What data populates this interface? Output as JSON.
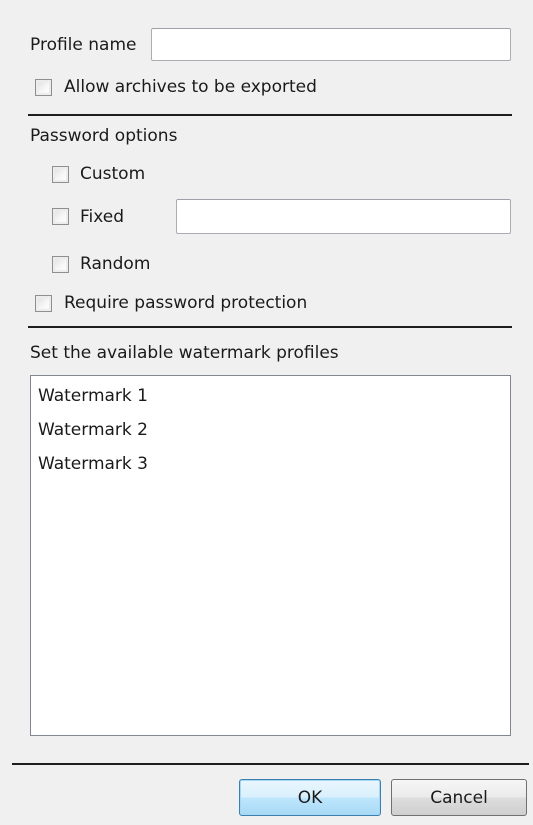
{
  "profile": {
    "name_label": "Profile name",
    "name_value": ""
  },
  "export": {
    "allow_archives_label": "Allow archives to be exported",
    "allow_archives_checked": false
  },
  "password": {
    "section_label": "Password options",
    "custom_label": "Custom",
    "custom_checked": false,
    "fixed_label": "Fixed",
    "fixed_checked": false,
    "fixed_value": "",
    "random_label": "Random",
    "random_checked": false,
    "require_label": "Require password protection",
    "require_checked": false
  },
  "watermark": {
    "section_label": "Set the available watermark profiles",
    "items": [
      "Watermark 1",
      "Watermark 2",
      "Watermark 3"
    ]
  },
  "buttons": {
    "ok_label": "OK",
    "cancel_label": "Cancel"
  },
  "colors": {
    "dialog_background": "#f0f0f0",
    "default_button_border": "#3c7fb1"
  }
}
